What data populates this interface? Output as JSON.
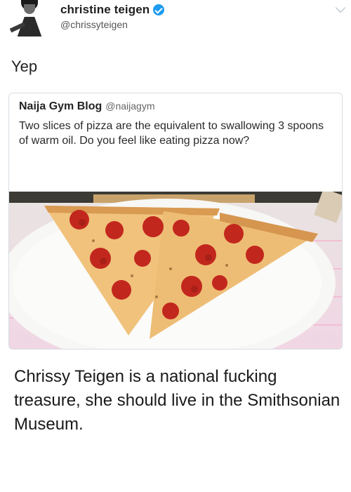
{
  "tweet": {
    "display_name": "christine teigen",
    "handle": "@chrissyteigen",
    "text": "Yep",
    "verified": true
  },
  "quoted_tweet": {
    "display_name": "Naija Gym Blog",
    "handle": "@naijagym",
    "text": "Two slices of pizza are the equivalent to swallowing 3 spoons of warm oil. Do you feel like eating pizza now?",
    "image_icon": "pizza-photo"
  },
  "caption": "Chrissy Teigen is a national fucking treasure, she should live in the Smithsonian Museum.",
  "colors": {
    "verified": "#1d9bf0",
    "card_border": "#d8dde2",
    "pepperoni": "#c2271d",
    "cheese": "#f2c27a"
  }
}
